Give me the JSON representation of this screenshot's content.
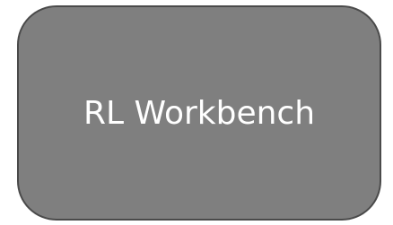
{
  "tile": {
    "label": "RL Workbench",
    "background_color": "#7f7f7f",
    "border_color": "#4a4a4a",
    "text_color": "#ffffff"
  }
}
